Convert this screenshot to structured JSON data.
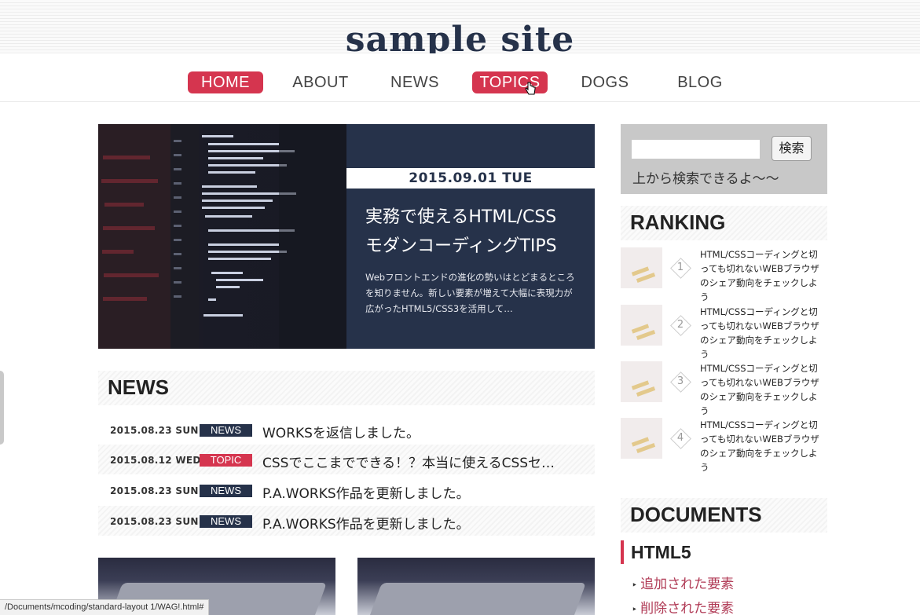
{
  "site": {
    "logo": "sample site"
  },
  "nav": {
    "items": [
      {
        "label": "HOME",
        "active": true
      },
      {
        "label": "ABOUT",
        "active": false
      },
      {
        "label": "NEWS",
        "active": false
      },
      {
        "label": "TOPICS",
        "active": true
      },
      {
        "label": "DOGS",
        "active": false
      },
      {
        "label": "BLOG",
        "active": false
      }
    ]
  },
  "hero": {
    "date": "2015.09.01 TUE",
    "title_line1": "実務で使えるHTML/CSS",
    "title_line2": "モダンコーディングTIPS",
    "text": "Webフロントエンドの進化の勢いはとどまるところを知りません。新しい要素が増えて大幅に表現力が広がったHTML5/CSS3を活用して…"
  },
  "news": {
    "heading": "NEWS",
    "items": [
      {
        "date": "2015.08.23 SUN",
        "badge": "NEWS",
        "title": "WORKSを返信しました。"
      },
      {
        "date": "2015.08.12 WED",
        "badge": "TOPIC",
        "title": "CSSでここまでできる！？本当に使えるCSSセ…"
      },
      {
        "date": "2015.08.23 SUN",
        "badge": "NEWS",
        "title": "P.A.WORKS作品を更新しました。"
      },
      {
        "date": "2015.08.23 SUN",
        "badge": "NEWS",
        "title": "P.A.WORKS作品を更新しました。"
      }
    ]
  },
  "search": {
    "button_label": "検索",
    "note": "上から検索できるよ〜〜",
    "value": ""
  },
  "ranking": {
    "heading": "RANKING",
    "items": [
      {
        "num": "1",
        "text": "HTML/CSSコーディングと切っても切れないWEBブラウザのシェア動向をチェックしよう"
      },
      {
        "num": "2",
        "text": "HTML/CSSコーディングと切っても切れないWEBブラウザのシェア動向をチェックしよう"
      },
      {
        "num": "3",
        "text": "HTML/CSSコーディングと切っても切れないWEBブラウザのシェア動向をチェックしよう"
      },
      {
        "num": "4",
        "text": "HTML/CSSコーディングと切っても切れないWEBブラウザのシェア動向をチェックしよう"
      }
    ]
  },
  "documents": {
    "heading": "DOCUMENTS",
    "subheading": "HTML5",
    "links": [
      "追加された要素",
      "削除された要素"
    ]
  },
  "status_bar": {
    "url": "/Documents/mcoding/standard-layout 1/WAG!.html#"
  },
  "colors": {
    "accent": "#d5354f",
    "navy": "#26324a",
    "sidebar_gray": "#c8c8c8"
  },
  "icons": {
    "cursor": "pointer-hand-icon"
  }
}
